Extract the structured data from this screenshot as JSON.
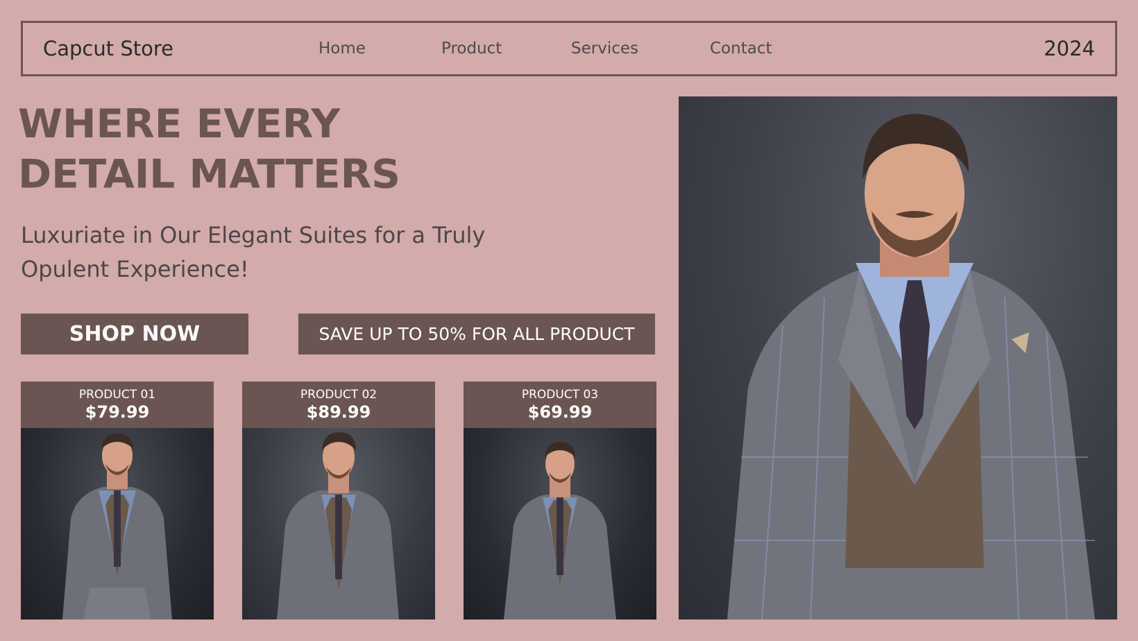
{
  "header": {
    "brand": "Capcut Store",
    "nav": [
      "Home",
      "Product",
      "Services",
      "Contact"
    ],
    "year": "2024"
  },
  "hero": {
    "headline_line1": "WHERE EVERY",
    "headline_line2": "DETAIL MATTERS",
    "subline": "Luxuriate in Our Elegant Suites for a Truly Opulent Experience!"
  },
  "buttons": {
    "shop_now": "SHOP NOW",
    "save_banner": "SAVE UP TO 50% FOR ALL PRODUCT"
  },
  "products": [
    {
      "name": "PRODUCT 01",
      "price": "$79.99"
    },
    {
      "name": "PRODUCT 02",
      "price": "$89.99"
    },
    {
      "name": "PRODUCT 03",
      "price": "$69.99"
    }
  ],
  "colors": {
    "background": "#d2abaa",
    "accent": "#6b5552",
    "text_dark": "#2a2a2a",
    "text_nav": "#4f4a4a"
  }
}
